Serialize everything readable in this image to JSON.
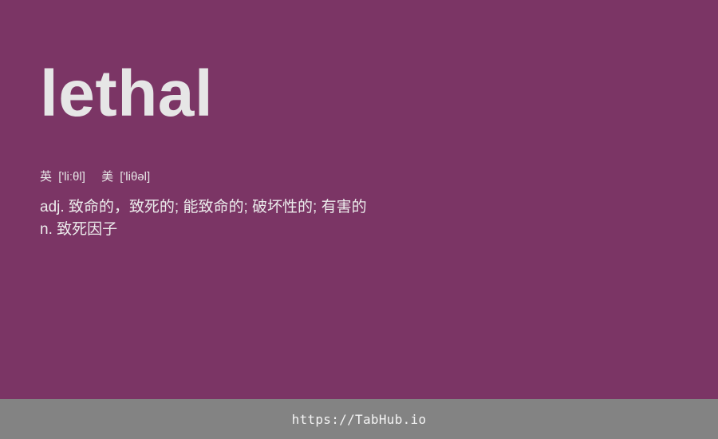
{
  "entry": {
    "word": "lethal",
    "phonetics": [
      {
        "label": "英",
        "ipa": "['liːθl]"
      },
      {
        "label": "美",
        "ipa": "['liθəl]"
      }
    ],
    "definitions": [
      "adj. 致命的，致死的; 能致命的; 破坏性的; 有害的",
      "n. 致死因子"
    ]
  },
  "footer": {
    "link_text": "https://TabHub.io"
  },
  "colors": {
    "background": "#7b3565",
    "footer_background": "#838383",
    "text": "#e6e6e6"
  }
}
